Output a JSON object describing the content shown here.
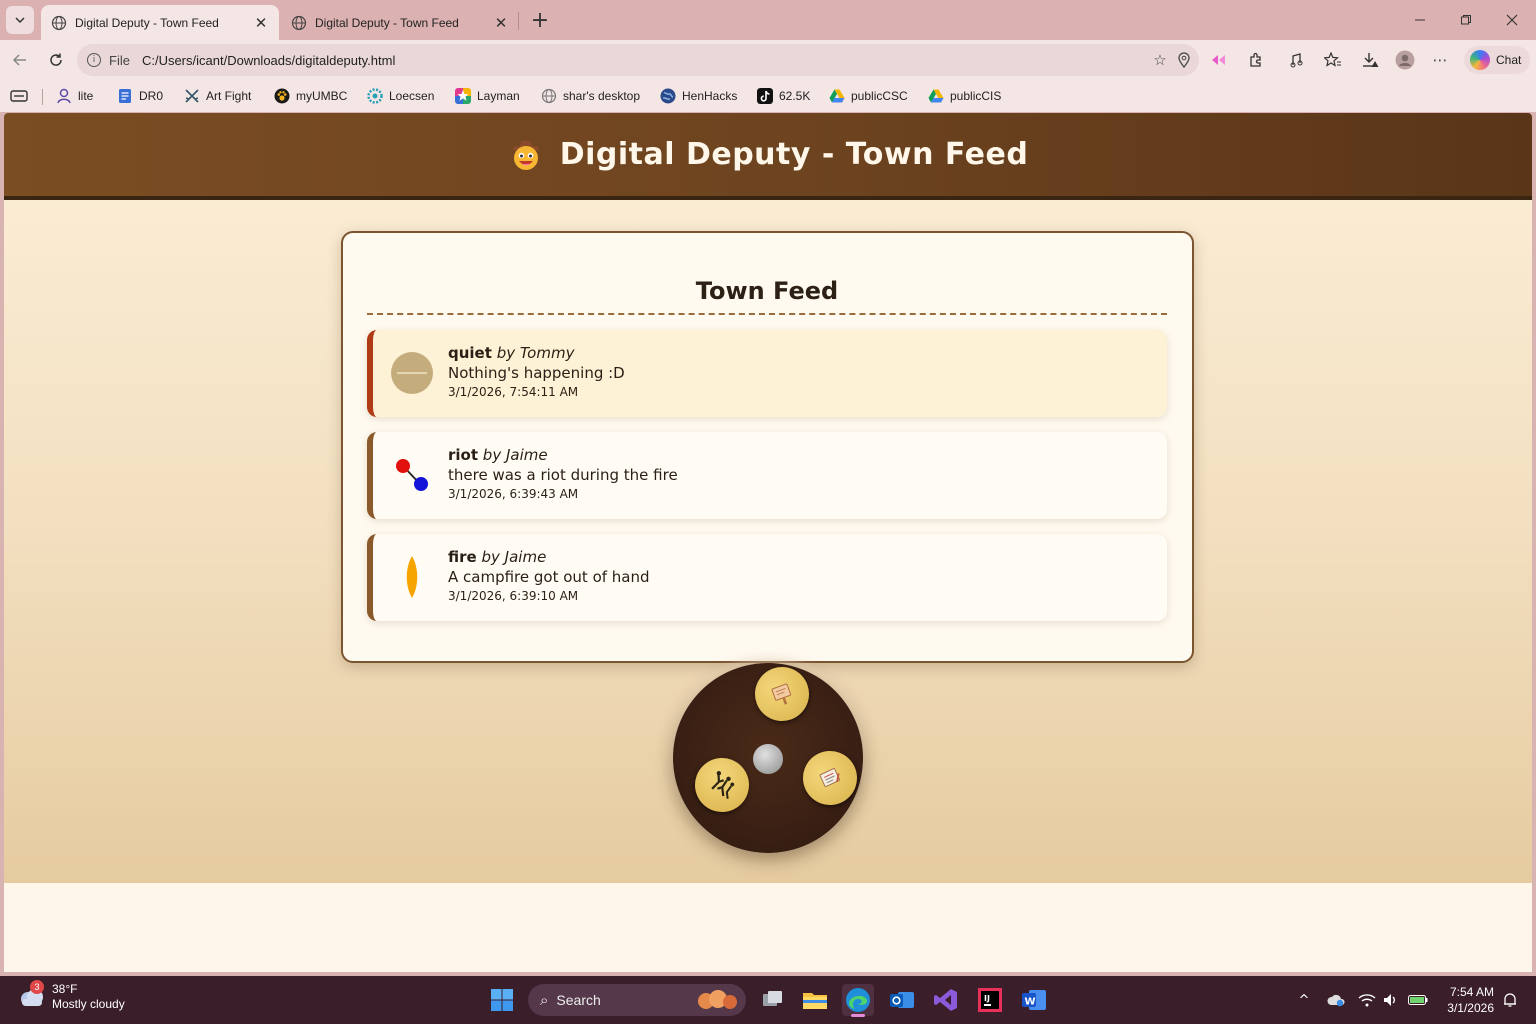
{
  "browser": {
    "tabs": [
      {
        "title": "Digital Deputy - Town Feed",
        "active": true
      },
      {
        "title": "Digital Deputy - Town Feed",
        "active": false
      }
    ],
    "address": {
      "scheme": "File",
      "url": "C:/Users/icant/Downloads/digitaldeputy.html"
    },
    "chat_label": "Chat",
    "bookmarks": [
      {
        "label": "lite",
        "icon": "person-icon",
        "color": "#5b4aa8"
      },
      {
        "label": "DR0",
        "icon": "doc-icon",
        "color": "#3a6fd8"
      },
      {
        "label": "Art Fight",
        "icon": "crossed-swords-icon",
        "color": "#3a5a6a"
      },
      {
        "label": "myUMBC",
        "icon": "paw-icon",
        "color": "#d9a316"
      },
      {
        "label": "Loecsen",
        "icon": "gear-flower-icon",
        "color": "#2aa0b8"
      },
      {
        "label": "Layman",
        "icon": "star-icon",
        "color": "#e0388a"
      },
      {
        "label": "shar's desktop",
        "icon": "globe-icon",
        "color": "#777777"
      },
      {
        "label": "HenHacks",
        "icon": "globe-icon",
        "color": "#2a4a8a"
      },
      {
        "label": "62.5K",
        "icon": "tiktok-icon",
        "color": "#111111"
      },
      {
        "label": "publicCSC",
        "icon": "drive-icon",
        "color": "#f4b400"
      },
      {
        "label": "publicCIS",
        "icon": "drive-icon",
        "color": "#f4b400"
      }
    ]
  },
  "page": {
    "title": "Digital Deputy - Town Feed",
    "feed_title": "Town Feed",
    "posts": [
      {
        "type": "quiet",
        "by_prefix": "by",
        "author": "Tommy",
        "body": "Nothing's happening :D",
        "time": "3/1/2026, 7:54:11 AM",
        "icon": "quiet-icon",
        "highlight": true
      },
      {
        "type": "riot",
        "by_prefix": "by",
        "author": "Jaime",
        "body": "there was a riot during the fire",
        "time": "3/1/2026, 6:39:43 AM",
        "icon": "riot-icon",
        "highlight": false
      },
      {
        "type": "fire",
        "by_prefix": "by",
        "author": "Jaime",
        "body": "A campfire got out of hand",
        "time": "3/1/2026, 6:39:10 AM",
        "icon": "fire-icon",
        "highlight": false
      }
    ],
    "wheel_buttons": [
      "sign-icon",
      "report-icon",
      "crowd-icon"
    ]
  },
  "taskbar": {
    "weather_temp": "38°F",
    "weather_cond": "Mostly cloudy",
    "weather_badge": "3",
    "search_label": "Search",
    "time": "7:54 AM",
    "date": "3/1/2026"
  },
  "colors": {
    "header_brown": "#6e4420",
    "card_border": "#7b5430",
    "highlight_border": "#b03a14",
    "wheel_gold": "#e3c25e"
  }
}
